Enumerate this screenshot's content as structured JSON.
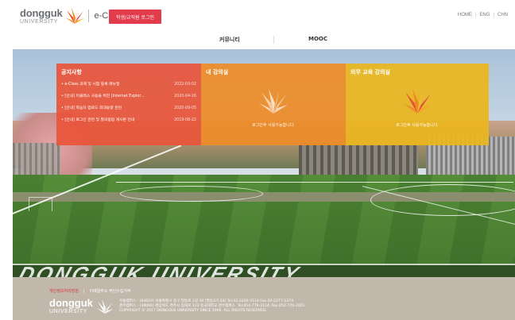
{
  "header": {
    "logo_main": "dongguk",
    "logo_sub": "UNIVERSITY",
    "logo_eclass": "e-Class",
    "login_button": "학생/교직원 로그인",
    "lang": [
      "HOME",
      "ENG",
      "CHN"
    ],
    "lang_separator": "|"
  },
  "nav": {
    "items": [
      "커뮤니티",
      "MOOC"
    ]
  },
  "hero": {
    "field_banner": "DONGGUK UNIVERSITY"
  },
  "panels": {
    "notice": {
      "title": "공지사항",
      "items": [
        {
          "title": "• e-Class 과제 및 시험 등록 매뉴얼",
          "date": "2022-03-02"
        },
        {
          "title": "• [안내] 이클래스 사용을 위한 [Internet Explor...",
          "date": "2020-04-16"
        },
        {
          "title": "• [안내] 학습자 업로드 최대용량 관련",
          "date": "2020-09-05"
        },
        {
          "title": "• [안내] 로그인 관련 및 질의응답 게시판 안내",
          "date": "2019-08-22"
        }
      ]
    },
    "my_course": {
      "title": "내 강의실",
      "message": "로그인후 사용가능합니다."
    },
    "mandatory": {
      "title": "의무 교육 강의실",
      "message": "로그인후 사용가능합니다."
    }
  },
  "footer": {
    "link_privacy": "개인정보처리방침",
    "link_email": "이메일주소 무단수집거부",
    "separator": "|",
    "logo_main": "dongguk",
    "logo_sub": "UNIVERSITY",
    "info_line1": "서울캠퍼스 : (04620) 서울특별시 중구 필동로 1길 30 [필동3가 26] Tel.02-2260-3114 Fax.02-2277-1274",
    "info_line2": "경주캠퍼스 : (38066) 경상북도 경주시 동대로 123 동국대학교 경주캠퍼스. Tel.054-770-2114, Fax.054-770-2001",
    "info_line3": "COPYRIGHT © 2017 DONGGUK UNIVERSITY SINCE 1906. ALL RIGHTS RESERVED."
  },
  "colors": {
    "login_button": "#e23b4b",
    "notice_panel": "#e8553a",
    "my_course_panel": "#ed8c28",
    "mandatory_panel": "#ebb61e",
    "footer": "#c1b7ab"
  },
  "icons": {
    "logo": "dongguk-flame-icon",
    "panel": "flame-icon"
  }
}
